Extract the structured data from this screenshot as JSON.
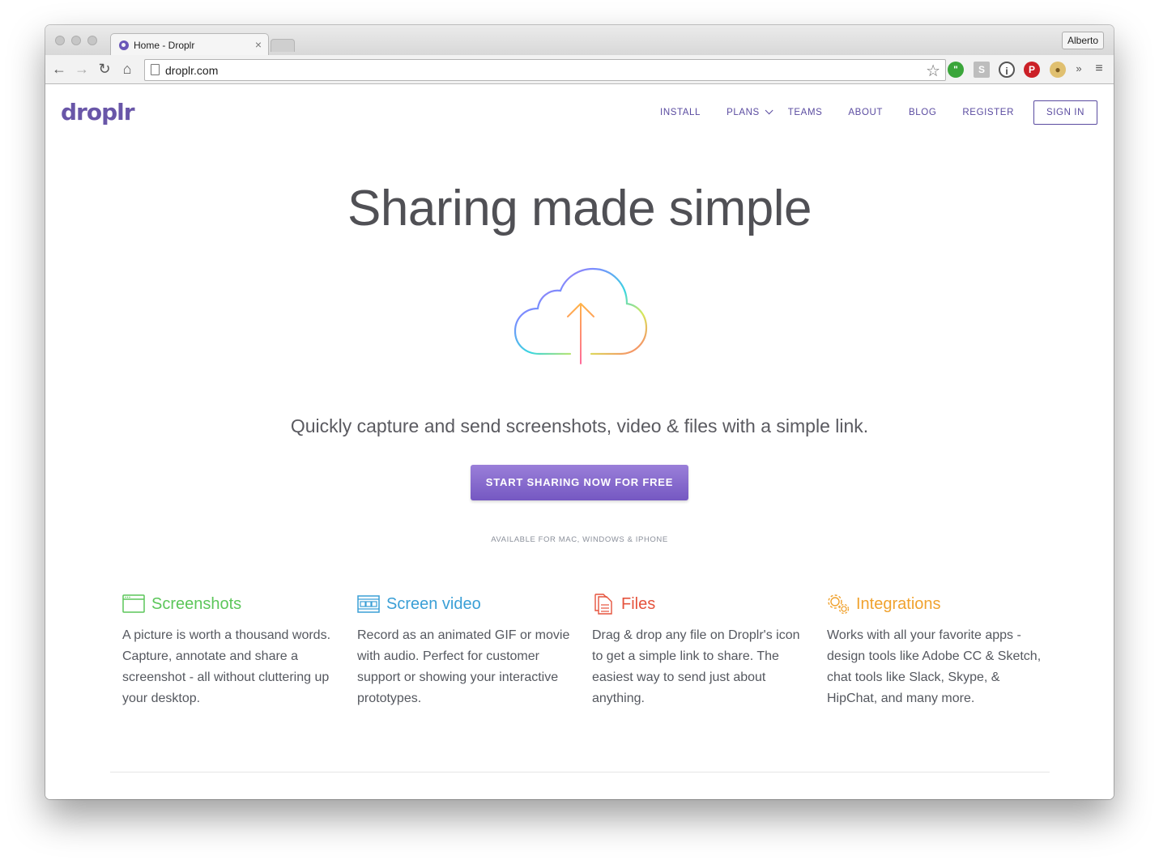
{
  "browser": {
    "tab_title": "Home - Droplr",
    "profile_name": "Alberto",
    "url": "droplr.com"
  },
  "site": {
    "logo_text": "droplr",
    "brand_color": "#6956a8",
    "nav": {
      "install": "INSTALL",
      "plans": "PLANS",
      "teams": "TEAMS",
      "about": "ABOUT",
      "blog": "BLOG",
      "register": "REGISTER",
      "sign_in": "SIGN IN"
    }
  },
  "hero": {
    "title": "Sharing made simple",
    "subtitle": "Quickly capture and send screenshots, video & files with a simple link.",
    "cta_label": "START SHARING NOW FOR FREE",
    "cta_note": "AVAILABLE FOR MAC, WINDOWS & IPHONE"
  },
  "features": [
    {
      "title": "Screenshots",
      "color": "#5cc65a",
      "icon": "screenshot-icon",
      "body": "A picture is worth a thousand words. Capture, annotate and share a screenshot - all without cluttering up your desktop."
    },
    {
      "title": "Screen video",
      "color": "#3a9fd6",
      "icon": "film-strip-icon",
      "body": "Record as an animated GIF or movie with audio. Perfect for customer support or showing your interactive prototypes."
    },
    {
      "title": "Files",
      "color": "#e5533d",
      "icon": "document-icon",
      "body": "Drag & drop any file on Droplr's icon to get a simple link to share. The easiest way to send just about anything."
    },
    {
      "title": "Integrations",
      "color": "#f0a22e",
      "icon": "gears-icon",
      "body": "Works with all your favorite apps - design tools like Adobe CC & Sketch, chat tools like Slack, Skype, & HipChat, and many more."
    }
  ]
}
